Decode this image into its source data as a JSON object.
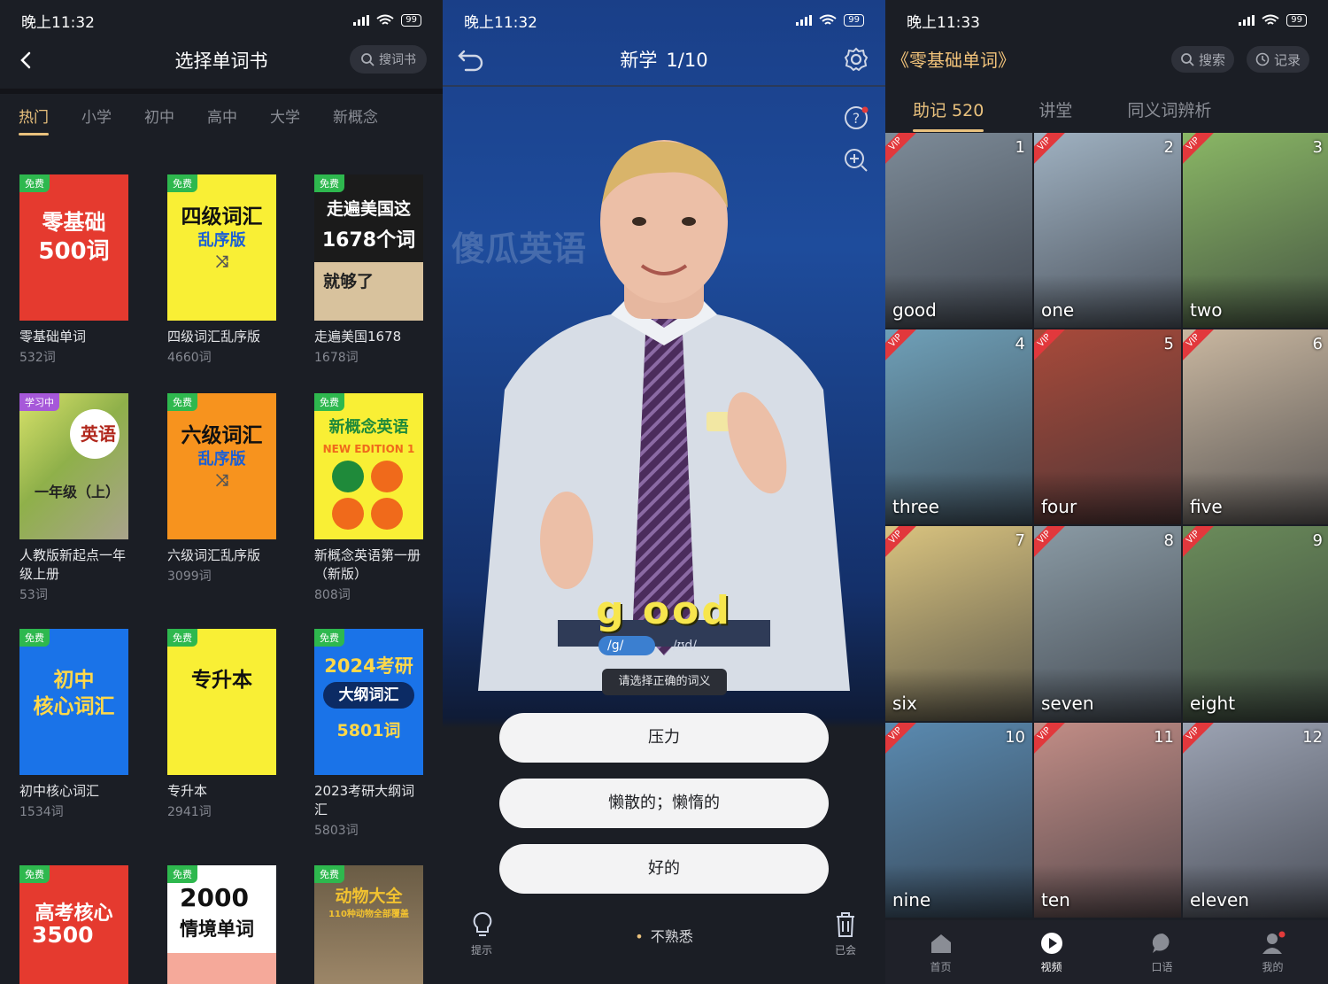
{
  "screen1": {
    "status": {
      "time": "晚上11:32",
      "battery": "99"
    },
    "title": "选择单词书",
    "search_label": "搜词书",
    "tabs": [
      "热门",
      "小学",
      "初中",
      "高中",
      "大学",
      "新概念"
    ],
    "books": [
      {
        "badge": "免费",
        "cover_line1": "零基础",
        "cover_line2": "500词",
        "name": "零基础单词",
        "count": "532词",
        "color": "#e53a2f"
      },
      {
        "badge": "免费",
        "cover_line1": "四级词汇",
        "cover_line2": "乱序版",
        "name": "四级词汇乱序版",
        "count": "4660词",
        "color": "#f9ef35"
      },
      {
        "badge": "免费",
        "cover_line1": "走遍美国这",
        "cover_line2": "1678个词",
        "cover_line3": "就够了",
        "name": "走遍美国1678",
        "count": "1678词",
        "color": "#1b1b1b"
      },
      {
        "badge": "学习中",
        "cover_line1": "英语",
        "cover_line2": "一年级（上）",
        "name": "人教版新起点一年级上册",
        "count": "53词",
        "color": "#8fb04a"
      },
      {
        "badge": "免费",
        "cover_line1": "六级词汇",
        "cover_line2": "乱序版",
        "name": "六级词汇乱序版",
        "count": "3099词",
        "color": "#f7931e"
      },
      {
        "badge": "免费",
        "cover_line1": "新概念英语",
        "cover_line2": "NEW EDITION 1",
        "name": "新概念英语第一册（新版）",
        "count": "808词",
        "color": "#f9ef35"
      },
      {
        "badge": "免费",
        "cover_line1": "初中",
        "cover_line2": "核心词汇",
        "name": "初中核心词汇",
        "count": "1534词",
        "color": "#1a73e8"
      },
      {
        "badge": "免费",
        "cover_line1": "专升本",
        "cover_line2": "",
        "name": "专升本",
        "count": "2941词",
        "color": "#f9ef35"
      },
      {
        "badge": "免费",
        "cover_line1": "2024考研",
        "cover_line2": "大纲词汇",
        "cover_line3": "5801词",
        "name": "2023考研大纲词汇",
        "count": "5803词",
        "color": "#1a73e8"
      },
      {
        "badge": "免费",
        "cover_line1": "高考核心",
        "cover_line2": "3500",
        "name": "",
        "count": "",
        "color": "#e53a2f"
      },
      {
        "badge": "免费",
        "cover_line1": "2000",
        "cover_line2": "情境单词",
        "name": "",
        "count": "",
        "color": "#ffffff"
      },
      {
        "badge": "免费",
        "cover_line1": "动物大全",
        "cover_line2": "110种动物全部覆盖",
        "name": "",
        "count": "",
        "color": "#8a7b5e"
      }
    ]
  },
  "screen2": {
    "status": {
      "time": "晚上11:32",
      "battery": "99"
    },
    "title": "新学",
    "progress": "1/10",
    "watermark": "傻瓜英语",
    "word": "g ood",
    "phonetic1": "/g/",
    "phonetic2": "/ʊd/",
    "prompt": "请选择正确的词义",
    "choices": [
      "压力",
      "懒散的；懒惰的",
      "好的"
    ],
    "hint_label": "提示",
    "unfamiliar_label": "不熟悉",
    "known_label": "已会"
  },
  "screen3": {
    "status": {
      "time": "晚上11:33",
      "battery": "99"
    },
    "title": "《零基础单词》",
    "search_label": "搜索",
    "record_label": "记录",
    "tabs": [
      "助记 520",
      "讲堂",
      "同义词辨析"
    ],
    "vip_label": "VIP",
    "tiles": [
      {
        "num": "1",
        "label": "good",
        "color": "#7d8b98"
      },
      {
        "num": "2",
        "label": "one",
        "color": "#9fb1c1"
      },
      {
        "num": "3",
        "label": "two",
        "color": "#8ab765"
      },
      {
        "num": "4",
        "label": "three",
        "color": "#6fa0b8"
      },
      {
        "num": "5",
        "label": "four",
        "color": "#a84a3a"
      },
      {
        "num": "6",
        "label": "five",
        "color": "#c9b7a0"
      },
      {
        "num": "7",
        "label": "six",
        "color": "#d9c37f"
      },
      {
        "num": "8",
        "label": "seven",
        "color": "#8a9aa4"
      },
      {
        "num": "9",
        "label": "eight",
        "color": "#6b8c5a"
      },
      {
        "num": "10",
        "label": "nine",
        "color": "#5a8ab0"
      },
      {
        "num": "11",
        "label": "ten",
        "color": "#c28d86"
      },
      {
        "num": "12",
        "label": "eleven",
        "color": "#9ca3b3"
      }
    ],
    "nav": [
      "首页",
      "视频",
      "口语",
      "我的"
    ]
  }
}
